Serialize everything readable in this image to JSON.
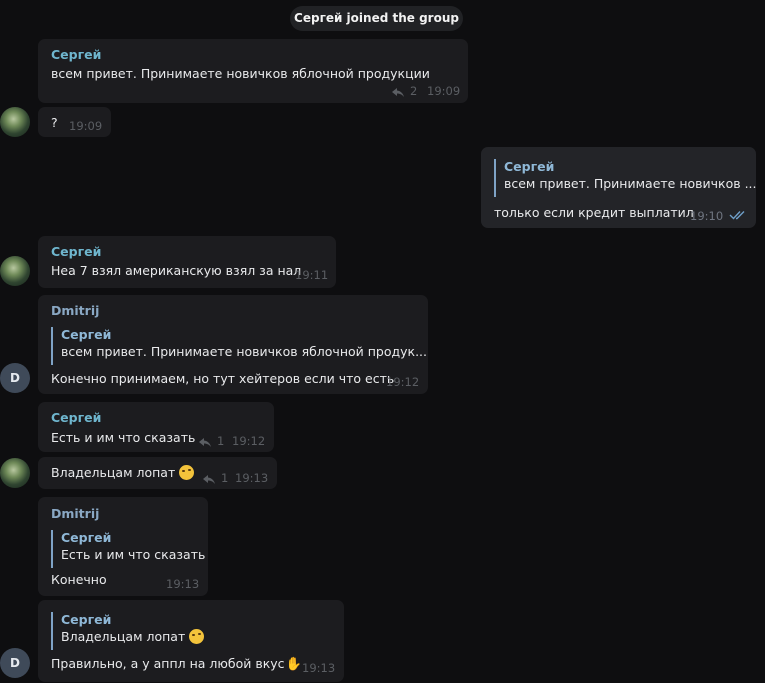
{
  "service_message": "Сергей joined the group",
  "messages": [
    {
      "id": "m1",
      "author": "Сергей",
      "text": "всем привет. Принимаете новичков яблочной продукции",
      "replies": "2",
      "time": "19:09"
    },
    {
      "id": "m2",
      "text": "?",
      "time": "19:09"
    },
    {
      "id": "m3",
      "quote_author": "Сергей",
      "quote_text": "всем привет. Принимаете новичков ...",
      "text": "только если кредит выплатил",
      "time": "19:10"
    },
    {
      "id": "m4",
      "author": "Сергей",
      "text": "Неа 7 взял американскую взял за нал",
      "time": "19:11"
    },
    {
      "id": "m5",
      "author": "Dmitrij",
      "quote_author": "Сергей",
      "quote_text": "всем привет. Принимаете новичков яблочной продук...",
      "text": "Конечно принимаем, но тут хейтеров если что есть",
      "time": "19:12"
    },
    {
      "id": "m6",
      "author": "Сергей",
      "text": "Есть и им что сказать",
      "replies": "1",
      "time": "19:12"
    },
    {
      "id": "m7",
      "text": "Владельцам лопат",
      "replies": "1",
      "time": "19:13"
    },
    {
      "id": "m8",
      "author": "Dmitrij",
      "quote_author": "Сергей",
      "quote_text": "Есть и им что сказать",
      "text": "Конечно",
      "time": "19:13"
    },
    {
      "id": "m9",
      "quote_author": "Сергей",
      "quote_text": "Владельцам лопат",
      "text": "Правильно, а у аппл на любой вкус",
      "time": "19:13"
    }
  ],
  "avatars": {
    "dmitrij_initial": "D"
  },
  "icons": {
    "reply": "reply-arrow-icon",
    "read": "double-check-icon",
    "emoji_grin": "rofl-emoji-icon",
    "emoji_thumb": "thumbs-up-emoji-icon"
  },
  "colors": {
    "background": "#0e0e10",
    "bubble": "#1c1c1f",
    "bubble_out": "#232428",
    "name_sergey": "#6fb6ce",
    "name_dmitrij": "#8aa8c4",
    "quote_bar": "#7fa3c6"
  }
}
